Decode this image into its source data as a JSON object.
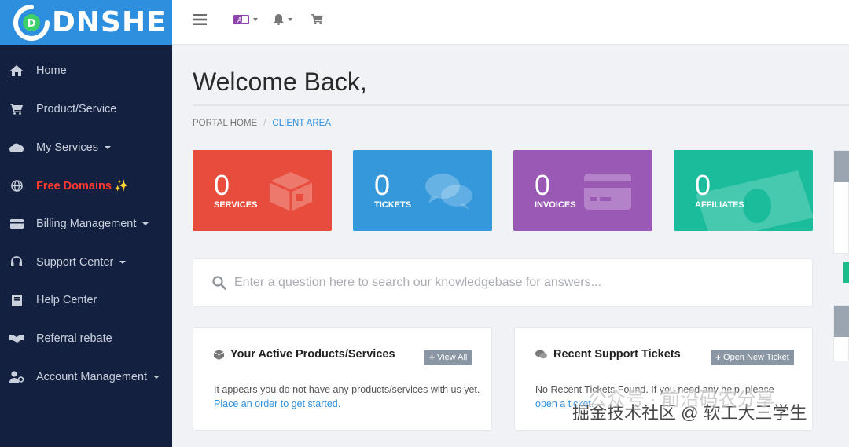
{
  "brand": {
    "logo_text": "DNSHE",
    "primary": "#2d8fdd",
    "sidebar_bg": "#142040"
  },
  "sidebar": {
    "items": [
      {
        "label": "Home",
        "icon": "home-icon",
        "has_caret": false
      },
      {
        "label": "Product/Service",
        "icon": "cart-icon",
        "has_caret": false
      },
      {
        "label": "My Services",
        "icon": "cloud-icon",
        "has_caret": true
      },
      {
        "label": "Free Domains ✨",
        "icon": "globe-icon",
        "has_caret": false
      },
      {
        "label": "Billing Management",
        "icon": "credit-card-icon",
        "has_caret": true
      },
      {
        "label": "Support Center",
        "icon": "headset-icon",
        "has_caret": true
      },
      {
        "label": "Help Center",
        "icon": "book-icon",
        "has_caret": false
      },
      {
        "label": "Referral rebate",
        "icon": "handshake-icon",
        "has_caret": false
      },
      {
        "label": "Account Management",
        "icon": "user-cog-icon",
        "has_caret": true
      }
    ]
  },
  "topbar": {
    "icons": [
      "menu-icon",
      "language-icon",
      "bell-icon",
      "cart-icon"
    ]
  },
  "main": {
    "title": "Welcome Back,",
    "breadcrumb": {
      "home": "PORTAL HOME",
      "separator": "/",
      "current": "CLIENT AREA"
    },
    "tiles": [
      {
        "count": "0",
        "label": "SERVICES",
        "color": "#e74c3c"
      },
      {
        "count": "0",
        "label": "TICKETS",
        "color": "#3498db"
      },
      {
        "count": "0",
        "label": "INVOICES",
        "color": "#9b59b6"
      },
      {
        "count": "0",
        "label": "AFFILIATES",
        "color": "#1abc9c"
      }
    ],
    "search": {
      "placeholder": "Enter a question here to search our knowledgebase for answers..."
    },
    "panels": {
      "products": {
        "title": "Your Active Products/Services",
        "button": "View All",
        "text": "It appears you do not have any products/services with us yet.",
        "link": "Place an order to get started."
      },
      "tickets": {
        "title": "Recent Support Tickets",
        "button": "Open New Ticket",
        "text": "No Recent Tickets Found. If you need any help, please",
        "link": "open a ticket."
      }
    }
  },
  "watermark": {
    "line1": "公众号 · 前沿码农分享",
    "line2": "掘金技术社区 @ 软工大三学生"
  }
}
